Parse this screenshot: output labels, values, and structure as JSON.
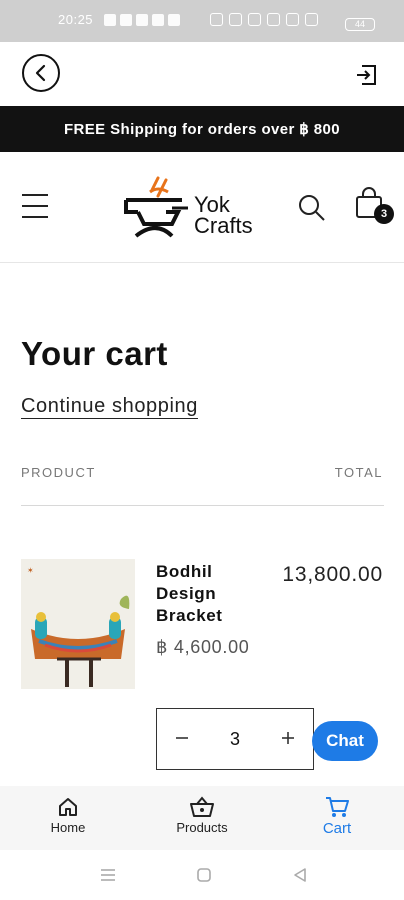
{
  "status_bar": {
    "time": "20:25",
    "battery": "44"
  },
  "announcement": "FREE Shipping for orders over ฿ 800",
  "brand": {
    "line1": "Yok",
    "line2": "Crafts"
  },
  "cart_badge": "3",
  "cart": {
    "title": "Your cart",
    "continue_label": "Continue shopping",
    "col_product": "PRODUCT",
    "col_total": "TOTAL",
    "items": [
      {
        "name": "Bodhil Design Bracket",
        "price": "฿ 4,600.00",
        "total": "13,800.00",
        "quantity": "3"
      }
    ]
  },
  "chat_label": "Chat",
  "bottom_nav": {
    "home": "Home",
    "products": "Products",
    "cart": "Cart"
  },
  "colors": {
    "accent": "#1e7be6",
    "announce_bg": "#121212",
    "logo_accent": "#e8731a"
  },
  "icons": [
    "back-icon",
    "exit-icon",
    "menu-icon",
    "search-icon",
    "cart-icon",
    "minus-icon",
    "plus-icon",
    "home-icon",
    "basket-icon",
    "shopping-cart-icon"
  ]
}
